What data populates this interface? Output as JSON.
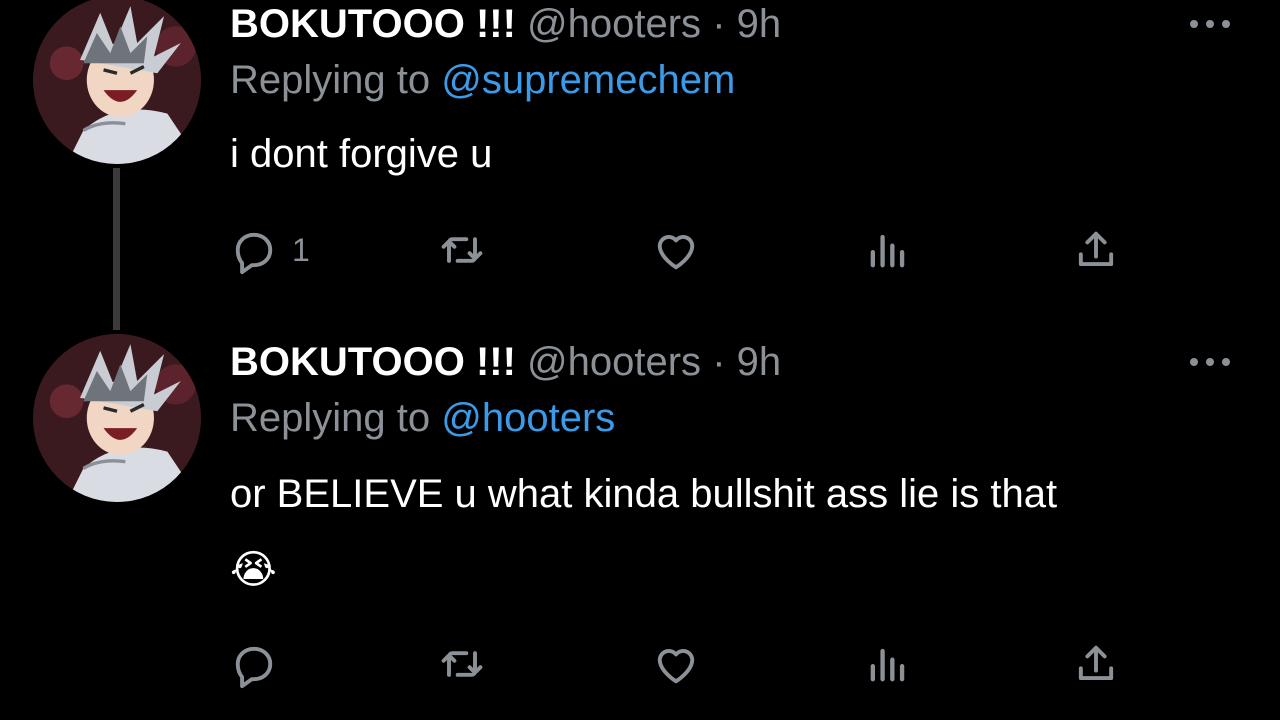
{
  "colors": {
    "background": "#000000",
    "name": "#ffffff",
    "muted": "#8b9197",
    "link": "#3b9be8",
    "thread_line": "#3a3a3a"
  },
  "tweets": [
    {
      "display_name": "BOKUTOOO !!!",
      "handle": "@hooters",
      "separator": "·",
      "time": "9h",
      "replying_prefix": "Replying to",
      "replying_to": "@supremechem",
      "text": "i dont forgive u",
      "emoji": "",
      "reply_count": "1",
      "icons": [
        "reply-icon",
        "retweet-icon",
        "like-icon",
        "views-icon",
        "share-icon",
        "more-icon"
      ]
    },
    {
      "display_name": "BOKUTOOO !!!",
      "handle": "@hooters",
      "separator": "·",
      "time": "9h",
      "replying_prefix": "Replying to",
      "replying_to": "@hooters",
      "text": "or BELIEVE u what kinda bullshit ass lie is that",
      "emoji": "😭",
      "reply_count": "",
      "icons": [
        "reply-icon",
        "retweet-icon",
        "like-icon",
        "views-icon",
        "share-icon",
        "more-icon"
      ]
    }
  ]
}
